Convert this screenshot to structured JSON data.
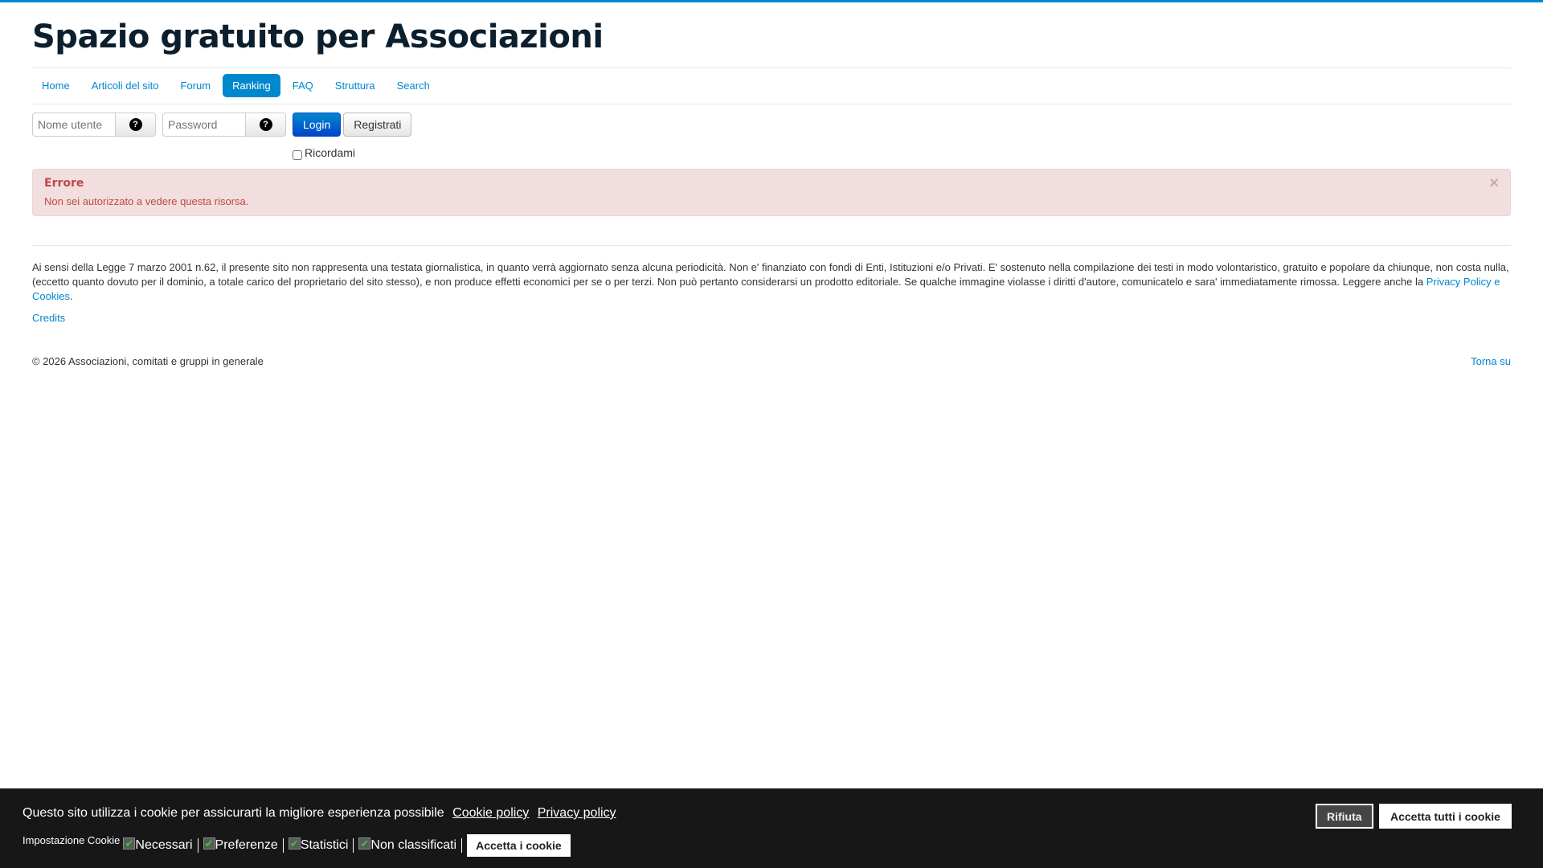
{
  "site_title": "Spazio gratuito per Associazioni",
  "nav": [
    {
      "label": "Home"
    },
    {
      "label": "Articoli del sito"
    },
    {
      "label": "Forum"
    },
    {
      "label": "Ranking",
      "active": true
    },
    {
      "label": "FAQ"
    },
    {
      "label": "Struttura"
    },
    {
      "label": "Search"
    }
  ],
  "login": {
    "username_placeholder": "Nome utente",
    "password_placeholder": "Password",
    "help_icon": "?",
    "login_label": "Login",
    "register_label": "Registrati",
    "remember_label": "Ricordami"
  },
  "alert": {
    "heading": "Errore",
    "message": "Non sei autorizzato a vedere questa risorsa.",
    "close": "×"
  },
  "footer": {
    "disclaimer": "Ai sensi della Legge 7 marzo 2001 n.62, il presente sito non rappresenta una testata giornalistica, in quanto verrà aggiornato senza alcuna periodicità. Non e' finanziato con fondi di Enti, Istituzioni e/o Privati. E' sostenuto nella compilazione dei testi in modo volontaristico, gratuito e popolare da chiunque, non costa nulla, (eccetto quanto dovuto per il dominio, a totale carico del proprietario del sito stesso), e non produce effetti economici per se o per terzi. Non può pertanto considerarsi un prodotto editoriale. Se qualche immagine violasse i diritti d'autore, comunicatelo e sara' immediatamente rimossa. Leggere anche la ",
    "privacy_link": "Privacy Policy e Cookies",
    "credits": "Credits",
    "copyright": "© 2026 Associazioni, comitati e gruppi in generale",
    "back_to_top": "Torna su"
  },
  "cookie_bar": {
    "text": "Questo sito utilizza i cookie per assicurarti la migliore esperienza possibile",
    "cookie_policy": "Cookie policy",
    "privacy_policy": "Privacy policy",
    "settings_label": "Impostazione Cookie",
    "categories": [
      "Necessari",
      "Preferenze",
      "Statistici",
      "Non classificati"
    ],
    "accept_selected": "Accetta i cookie",
    "reject": "Rifiuta",
    "accept_all": "Accetta tutti i cookie"
  }
}
